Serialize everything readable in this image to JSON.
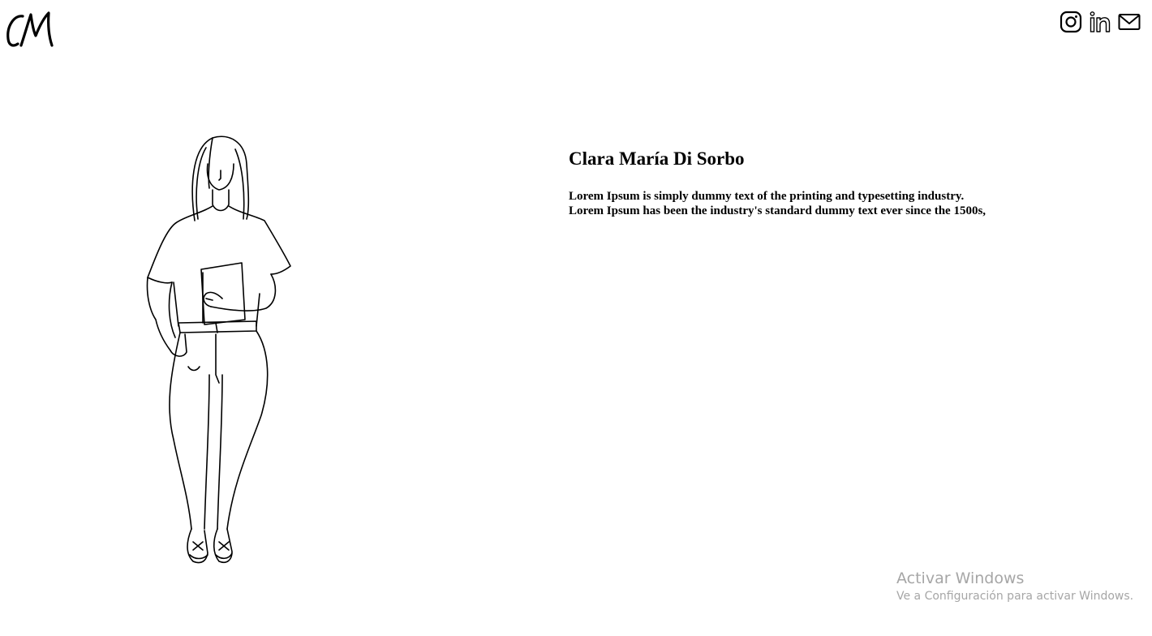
{
  "header": {
    "logo_text": "CM",
    "social": [
      {
        "icon": "instagram-icon"
      },
      {
        "icon": "linkedin-icon"
      },
      {
        "icon": "mail-icon"
      }
    ]
  },
  "hero": {
    "illustration": "woman-holding-book-line-drawing",
    "name": "Clara María Di Sorbo",
    "description_line1": "Lorem Ipsum is simply dummy text of the printing and typesetting industry.",
    "description_line2": "Lorem Ipsum has been the industry's standard dummy text ever since the 1500s,"
  },
  "system_overlay": {
    "title": "Activar Windows",
    "subtitle": "Ve a Configuración para activar Windows."
  },
  "colors": {
    "background": "#ffffff",
    "text": "#000000",
    "watermark": "#a6a6a6"
  }
}
